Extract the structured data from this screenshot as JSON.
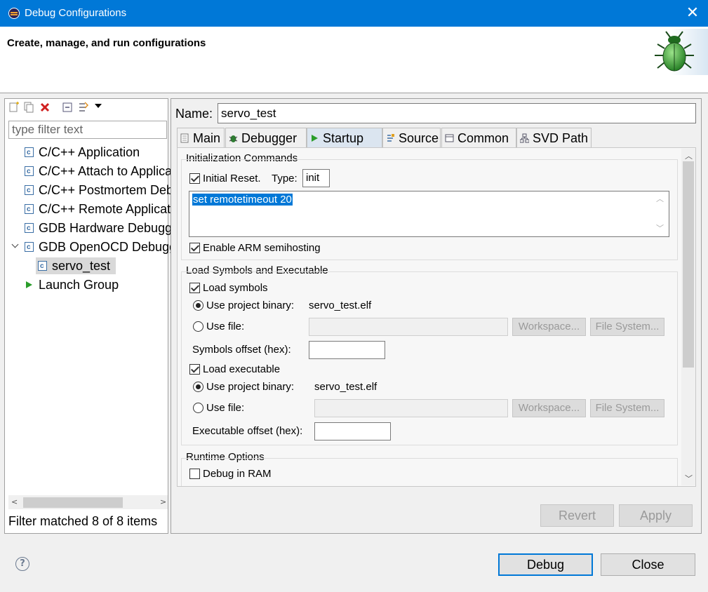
{
  "window": {
    "title": "Debug Configurations",
    "close_glyph": "✕"
  },
  "header": {
    "title": "Create, manage, and run configurations"
  },
  "left": {
    "filter_placeholder": "type filter text",
    "tree": [
      {
        "label": "C/C++ Application"
      },
      {
        "label": "C/C++ Attach to Application"
      },
      {
        "label": "C/C++ Postmortem Debugger"
      },
      {
        "label": "C/C++ Remote Application"
      },
      {
        "label": "GDB Hardware Debugging"
      },
      {
        "label": "GDB OpenOCD Debugging"
      },
      {
        "label": "servo_test"
      },
      {
        "label": "Launch Group"
      }
    ],
    "status": "Filter matched 8 of 8 items"
  },
  "config": {
    "name_label": "Name:",
    "name_value": "servo_test",
    "tabs": [
      {
        "label": "Main"
      },
      {
        "label": "Debugger"
      },
      {
        "label": "Startup"
      },
      {
        "label": "Source"
      },
      {
        "label": "Common"
      },
      {
        "label": "SVD Path"
      }
    ]
  },
  "startup": {
    "init_group": "Initialization Commands",
    "initial_reset": "Initial Reset.",
    "type_label": "Type:",
    "type_value": "init",
    "init_commands": "set remotetimeout 20",
    "semihosting": "Enable ARM semihosting",
    "load_group": "Load Symbols and Executable",
    "load_symbols": "Load symbols",
    "use_project_binary": "Use project binary:",
    "symbols_binary": "servo_test.elf",
    "use_file": "Use file:",
    "workspace": "Workspace...",
    "file_system": "File System...",
    "symbols_offset": "Symbols offset (hex):",
    "load_executable": "Load executable",
    "exec_binary": "servo_test.elf",
    "exec_offset": "Executable offset (hex):",
    "runtime_group": "Runtime Options",
    "debug_in_ram": "Debug in RAM"
  },
  "actions": {
    "revert": "Revert",
    "apply": "Apply",
    "debug": "Debug",
    "close": "Close",
    "help": "?"
  },
  "colors": {
    "titlebar": "#0078d7",
    "selection": "#0078d7",
    "default_border": "#0078d7"
  }
}
